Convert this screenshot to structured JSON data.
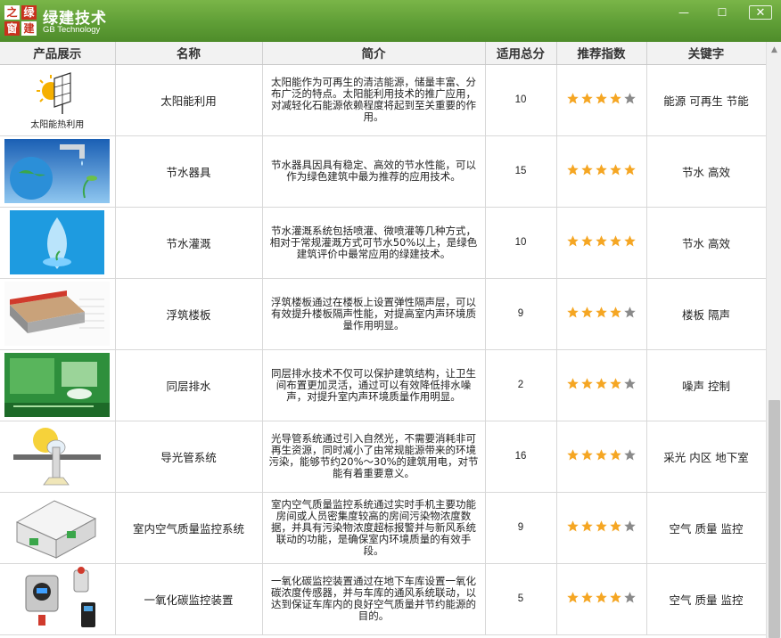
{
  "app": {
    "logo_chars": [
      "之",
      "绿",
      "窗",
      "建"
    ],
    "title": "绿建技术",
    "subtitle": "GB Technology",
    "colors": {
      "titlebar": "#5f9e36",
      "star_on": "#f5a623",
      "star_off": "#8a8a8a"
    }
  },
  "window_controls": {
    "minimize": "—",
    "maximize": "☐",
    "close": "✕"
  },
  "table": {
    "headers": [
      "产品展示",
      "名称",
      "简介",
      "适用总分",
      "推荐指数",
      "关键字"
    ],
    "rows": [
      {
        "image_caption": "太阳能热利用",
        "image_icon": "solar-panel-icon",
        "name": "太阳能利用",
        "desc": "太阳能作为可再生的清洁能源，储量丰富、分布广泛的特点。太阳能利用技术的推广应用，对减轻化石能源依赖程度将起到至关重要的作用。",
        "score": "10",
        "stars": 4,
        "keywords": "能源 可再生 节能"
      },
      {
        "image_caption": "",
        "image_icon": "water-faucet-earth-icon",
        "name": "节水器具",
        "desc": "节水器具因具有稳定、高效的节水性能，可以作为绿色建筑中最为推荐的应用技术。",
        "score": "15",
        "stars": 5,
        "keywords": "节水 高效"
      },
      {
        "image_caption": "",
        "image_icon": "water-drop-icon",
        "name": "节水灌溉",
        "desc": "节水灌溉系统包括喷灌、微喷灌等几种方式，相对于常规灌溉方式可节水50%以上，是绿色建筑评价中最常应用的绿建技术。",
        "score": "10",
        "stars": 5,
        "keywords": "节水 高效"
      },
      {
        "image_caption": "",
        "image_icon": "floating-floor-icon",
        "name": "浮筑楼板",
        "desc": "浮筑楼板通过在楼板上设置弹性隔声层，可以有效提升楼板隔声性能，对提高室内声环境质量作用明显。",
        "score": "9",
        "stars": 4,
        "keywords": "楼板 隔声"
      },
      {
        "image_caption": "",
        "image_icon": "bathroom-drain-icon",
        "name": "同层排水",
        "desc": "同层排水技术不仅可以保护建筑结构，让卫生间布置更加灵活，通过可以有效降低排水噪声，对提升室内声环境质量作用明显。",
        "score": "2",
        "stars": 4,
        "keywords": "噪声 控制"
      },
      {
        "image_caption": "",
        "image_icon": "light-pipe-icon",
        "name": "导光管系统",
        "desc": "光导管系统通过引入自然光，不需要消耗非可再生资源，同时减小了由常规能源带来的环境污染，能够节约20%～30%的建筑用电，对节能有着重要意义。",
        "score": "16",
        "stars": 4,
        "keywords": "采光 内区 地下室"
      },
      {
        "image_caption": "",
        "image_icon": "house-air-monitor-icon",
        "name": "室内空气质量监控系统",
        "desc": "室内空气质量监控系统通过实时手机主要功能房间或人员密集度较高的房间污染物浓度数据，并具有污染物浓度超标报警并与新风系统联动的功能，是确保室内环境质量的有效手段。",
        "score": "9",
        "stars": 4,
        "keywords": "空气 质量 监控"
      },
      {
        "image_caption": "",
        "image_icon": "co-detector-icon",
        "name": "一氧化碳监控装置",
        "desc": "一氧化碳监控装置通过在地下车库设置一氧化碳浓度传感器，并与车库的通风系统联动，以达到保证车库内的良好空气质量并节约能源的目的。",
        "score": "5",
        "stars": 4,
        "keywords": "空气 质量 监控"
      }
    ]
  }
}
